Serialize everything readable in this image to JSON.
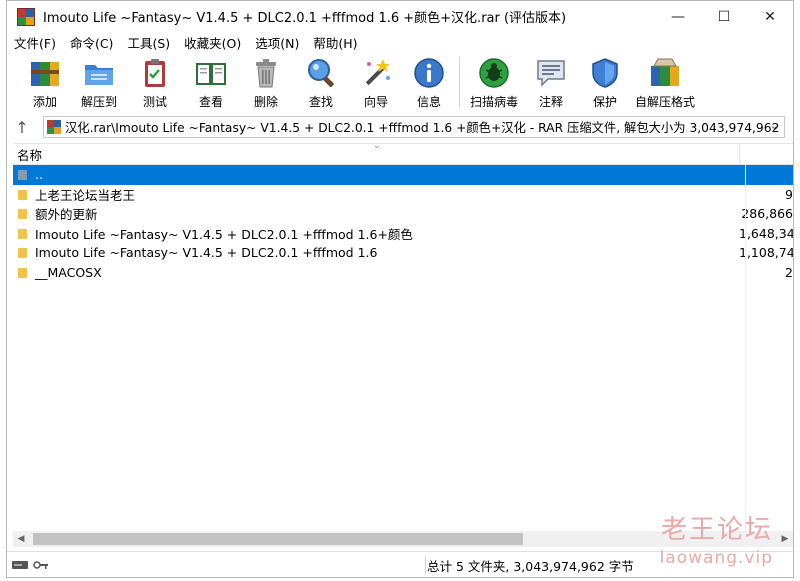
{
  "window": {
    "title": "Imouto Life ~Fantasy~ V1.4.5 + DLC2.0.1 +fffmod 1.6 +颜色+汉化.rar (评估版本)",
    "controls": {
      "minimize": "—",
      "maximize": "☐",
      "close": "✕"
    }
  },
  "menu": [
    {
      "label": "文件(F)"
    },
    {
      "label": "命令(C)"
    },
    {
      "label": "工具(S)"
    },
    {
      "label": "收藏夹(O)"
    },
    {
      "label": "选项(N)"
    },
    {
      "label": "帮助(H)"
    }
  ],
  "toolbar": [
    {
      "label": "添加",
      "icon": "add-archive-icon"
    },
    {
      "label": "解压到",
      "icon": "extract-folder-icon"
    },
    {
      "label": "测试",
      "icon": "test-clipboard-icon"
    },
    {
      "label": "查看",
      "icon": "view-book-icon"
    },
    {
      "label": "删除",
      "icon": "trash-icon"
    },
    {
      "label": "查找",
      "icon": "magnifier-icon"
    },
    {
      "label": "向导",
      "icon": "wizard-wand-icon"
    },
    {
      "label": "信息",
      "icon": "info-icon"
    },
    {
      "label": "扫描病毒",
      "icon": "virus-scan-icon"
    },
    {
      "label": "注释",
      "icon": "comment-icon"
    },
    {
      "label": "保护",
      "icon": "shield-icon"
    },
    {
      "label": "自解压格式",
      "icon": "sfx-archive-icon"
    }
  ],
  "address": {
    "path": "汉化.rar\\Imouto Life ~Fantasy~ V1.4.5 + DLC2.0.1 +fffmod 1.6 +颜色+汉化 - RAR 压缩文件, 解包大小为 3,043,974,962 字节"
  },
  "columns": {
    "name": "名称"
  },
  "files": [
    {
      "name": "..",
      "size": "",
      "selected": true,
      "type": "up"
    },
    {
      "name": "上老王论坛当老王",
      "size": "9",
      "selected": false,
      "type": "folder"
    },
    {
      "name": "额外的更新",
      "size": "286,866",
      "selected": false,
      "type": "folder"
    },
    {
      "name": "Imouto Life ~Fantasy~ V1.4.5 + DLC2.0.1 +fffmod 1.6+颜色",
      "size": "1,648,34",
      "selected": false,
      "type": "folder"
    },
    {
      "name": "Imouto Life ~Fantasy~ V1.4.5 + DLC2.0.1 +fffmod 1.6",
      "size": "1,108,74",
      "selected": false,
      "type": "folder"
    },
    {
      "name": "__MACOSX",
      "size": "2",
      "selected": false,
      "type": "folder"
    }
  ],
  "status": {
    "summary": "总计 5 文件夹, 3,043,974,962 字节"
  },
  "watermark": {
    "cn": "老王论坛",
    "en": "laowang.vip"
  },
  "colors": {
    "selection": "#0078d7",
    "folder": "#f1c14c"
  }
}
